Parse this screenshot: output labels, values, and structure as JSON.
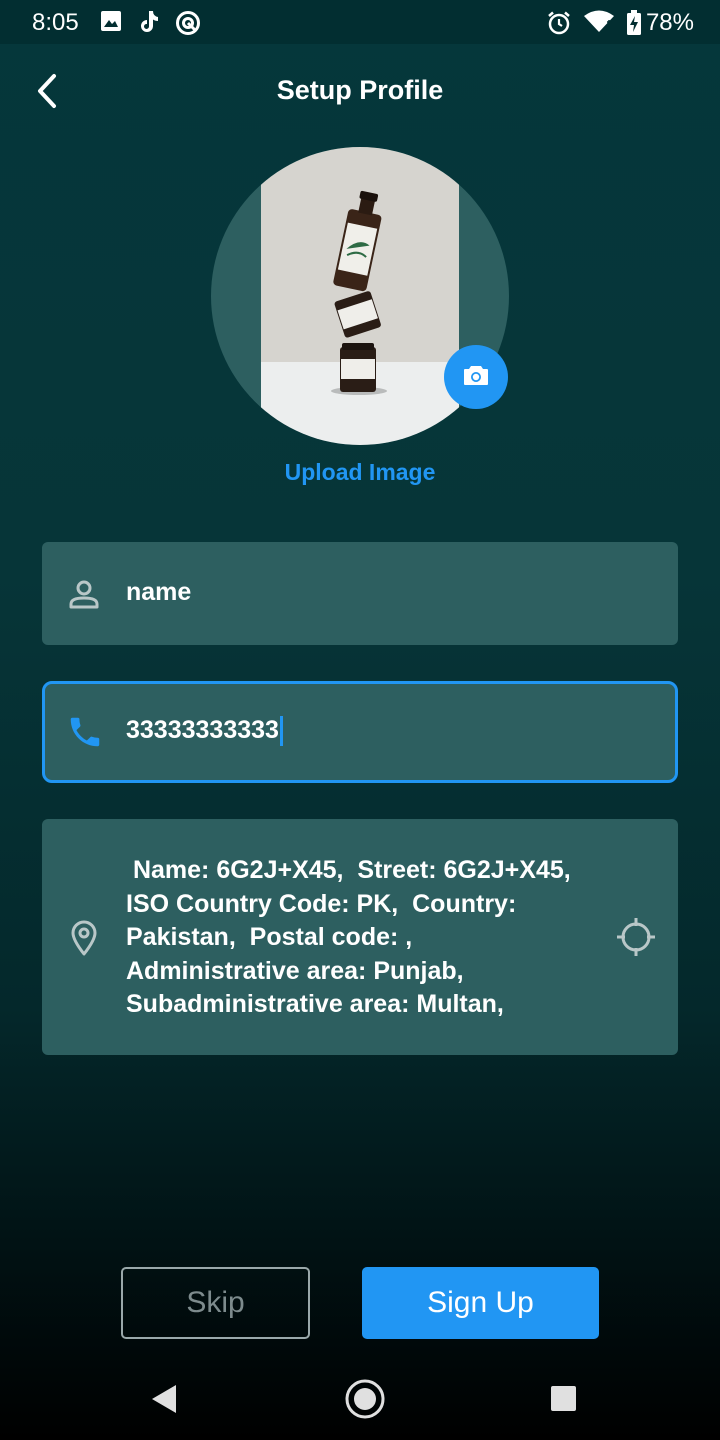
{
  "status_bar": {
    "time": "8:05",
    "battery": "78%",
    "icons": [
      "image-icon",
      "music-app-icon",
      "sync-icon",
      "alarm-icon",
      "wifi-icon",
      "battery-charging-icon"
    ]
  },
  "header": {
    "title": "Setup Profile",
    "back_icon": "chevron-left-icon"
  },
  "profile": {
    "upload_label": "Upload Image",
    "camera_icon": "camera-icon"
  },
  "form": {
    "name": {
      "placeholder": "name",
      "value": "",
      "icon": "person-icon"
    },
    "phone": {
      "value": "33333333333",
      "icon": "phone-icon",
      "focused": true
    },
    "address": {
      "value": " Name: 6G2J+X45,  Street: 6G2J+X45,  ISO Country Code: PK,  Country: Pakistan,  Postal code: ,  Administrative area: Punjab,  Subadministrative area: Multan,",
      "icon": "location-pin-icon",
      "locate_icon": "gps-locate-icon"
    }
  },
  "actions": {
    "skip_label": "Skip",
    "signup_label": "Sign Up"
  },
  "colors": {
    "accent": "#2196f3",
    "field_bg": "#2d5f60",
    "bg_top": "#05373b"
  }
}
